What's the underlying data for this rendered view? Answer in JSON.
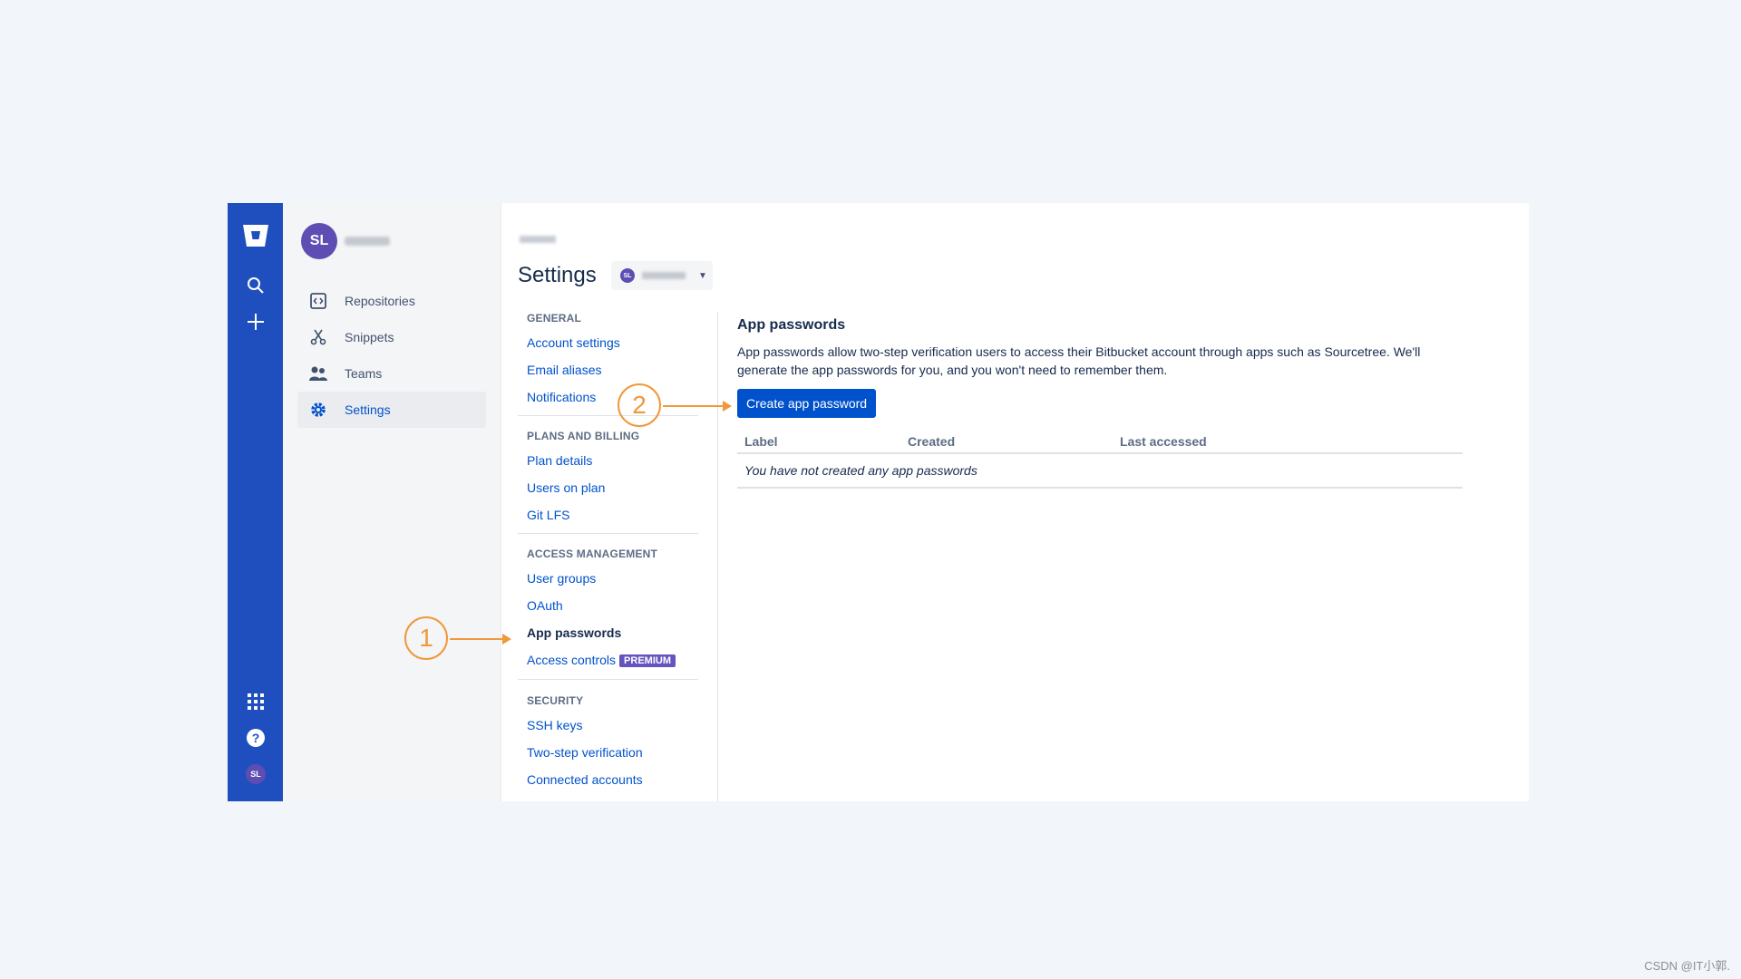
{
  "global_nav": {
    "icons": [
      "bitbucket-logo-icon",
      "search-icon",
      "plus-icon",
      "apps-grid-icon",
      "help-icon"
    ],
    "avatar_initials": "SL"
  },
  "sidebar": {
    "avatar_initials": "SL",
    "items": [
      {
        "label": "Repositories",
        "icon": "code-icon"
      },
      {
        "label": "Snippets",
        "icon": "scissors-icon"
      },
      {
        "label": "Teams",
        "icon": "people-icon"
      },
      {
        "label": "Settings",
        "icon": "gear-icon",
        "active": true
      }
    ]
  },
  "header": {
    "title": "Settings",
    "account_avatar": "SL"
  },
  "settings_nav": {
    "general": {
      "heading": "GENERAL",
      "items": [
        "Account settings",
        "Email aliases",
        "Notifications"
      ]
    },
    "plans": {
      "heading": "PLANS AND BILLING",
      "items": [
        "Plan details",
        "Users on plan",
        "Git LFS"
      ]
    },
    "access": {
      "heading": "ACCESS MANAGEMENT",
      "items": [
        "User groups",
        "OAuth",
        "App passwords",
        "Access controls"
      ],
      "badge": "PREMIUM"
    },
    "security": {
      "heading": "SECURITY",
      "items": [
        "SSH keys",
        "Two-step verification",
        "Connected accounts"
      ]
    }
  },
  "content": {
    "title": "App passwords",
    "description": "App passwords allow two-step verification users to access their Bitbucket account through apps such as Sourcetree. We'll generate the app passwords for you, and you won't need to remember them.",
    "create_button": "Create app password",
    "table": {
      "columns": [
        "Label",
        "Created",
        "Last accessed"
      ],
      "empty_message": "You have not created any app passwords"
    }
  },
  "annotations": {
    "step1": "1",
    "step2": "2",
    "color": "#f0983a"
  },
  "watermark": "CSDN @IT小郭."
}
